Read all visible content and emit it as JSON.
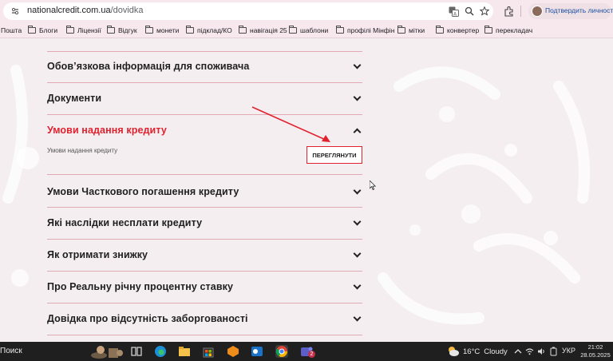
{
  "browser": {
    "url_host": "nationalcredit.com.ua",
    "url_path": "/dovidka",
    "profile_label": "Подтвердить личность"
  },
  "bookmarks": [
    "Пошта",
    "Блоги",
    "Ліцензії",
    "Відгук",
    "монети",
    "підклад/КО",
    "навігація 25",
    "шаблони",
    "профілі Мінфін",
    "мітки",
    "конвертер",
    "перекладач"
  ],
  "accordion": {
    "items": [
      {
        "title": "Обов’язкова інформація для споживача",
        "expanded": false
      },
      {
        "title": "Документи",
        "expanded": false
      },
      {
        "title": "Умови надання кредиту",
        "expanded": true
      },
      {
        "title": "Умови Часткового погашення кредиту",
        "expanded": false
      },
      {
        "title": "Які наслідки несплати кредиту",
        "expanded": false
      },
      {
        "title": "Як отримати знижку",
        "expanded": false
      },
      {
        "title": "Про Реальну річну процентну ставку",
        "expanded": false
      },
      {
        "title": "Довідка про відсутність заборгованості",
        "expanded": false
      }
    ],
    "expanded_content": {
      "text": "Умови надання кредиту",
      "button_label": "ПЕРЕГЛЯНУТИ"
    }
  },
  "colors": {
    "accent": "#e0222e",
    "divider": "#e0a9b3",
    "chrome": "#f7e8ee",
    "taskbar": "#1f1f1f"
  },
  "taskbar": {
    "search_label": "Поиск",
    "weather_temp": "16°C",
    "weather_text": "Cloudy",
    "language": "УКР",
    "time": "21:02",
    "date": "28.05.2025",
    "teams_badge": "2"
  }
}
